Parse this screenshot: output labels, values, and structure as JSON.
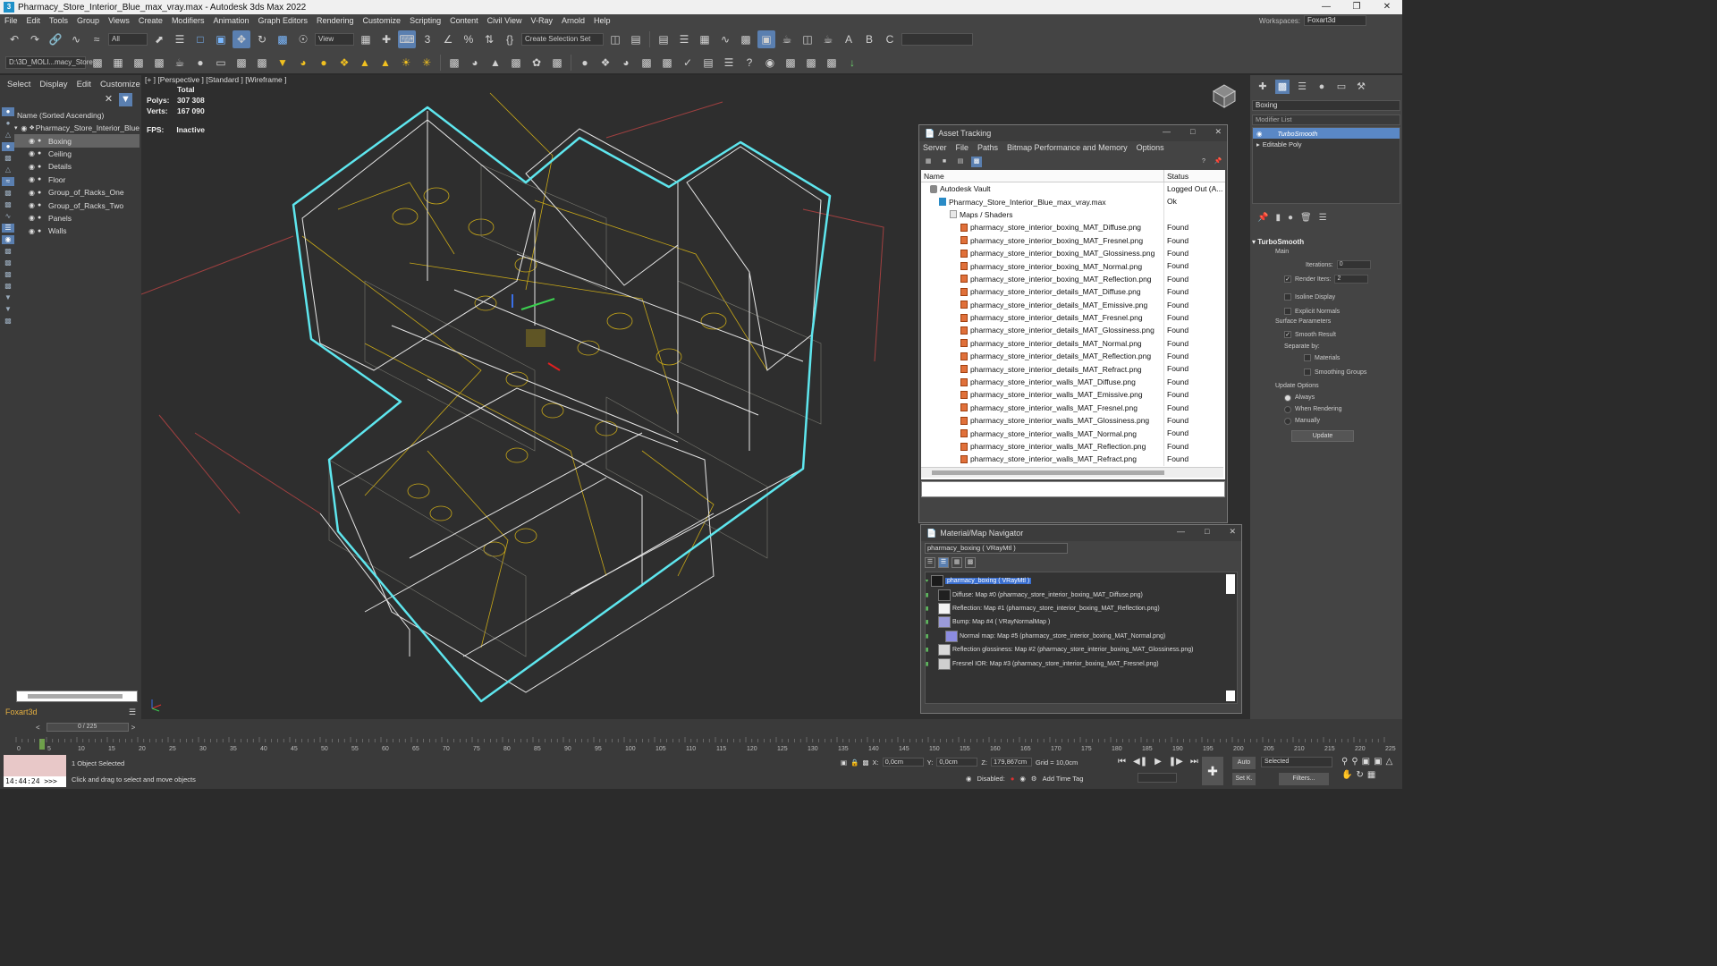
{
  "window": {
    "title": "Pharmacy_Store_Interior_Blue_max_vray.max - Autodesk 3ds Max 2022",
    "app_icon": "3"
  },
  "menu": [
    "File",
    "Edit",
    "Tools",
    "Group",
    "Views",
    "Create",
    "Modifiers",
    "Animation",
    "Graph Editors",
    "Rendering",
    "Customize",
    "Scripting",
    "Content",
    "Civil View",
    "V-Ray",
    "Arnold",
    "Help"
  ],
  "workspace": {
    "label": "Workspaces:",
    "value": "Foxart3d"
  },
  "toolbar": {
    "filter_dropdown": "All",
    "view_dropdown": "View",
    "selection_set": "Create Selection Set",
    "project_path": "D:\\3D_MOLI...macy_Store"
  },
  "scene_explorer": {
    "tabs": [
      "Select",
      "Display",
      "Edit",
      "Customize"
    ],
    "column_header": "Name (Sorted Ascending)",
    "root": "Pharmacy_Store_Interior_Blue",
    "items": [
      {
        "name": "Boxing",
        "selected": true
      },
      {
        "name": "Ceiling",
        "selected": false
      },
      {
        "name": "Details",
        "selected": false
      },
      {
        "name": "Floor",
        "selected": false
      },
      {
        "name": "Group_of_Racks_One",
        "selected": false
      },
      {
        "name": "Group_of_Racks_Two",
        "selected": false
      },
      {
        "name": "Panels",
        "selected": false
      },
      {
        "name": "Walls",
        "selected": false
      }
    ],
    "workspace_name": "Foxart3d"
  },
  "viewport": {
    "label": "[+ ] [Perspective ] [Standard ] [Wireframe ]",
    "stats_total": "Total",
    "polys_label": "Polys:",
    "polys_value": "307 308",
    "verts_label": "Verts:",
    "verts_value": "167 090",
    "fps_label": "FPS:",
    "fps_value": "Inactive"
  },
  "command_panel": {
    "object_name": "Boxing",
    "modifier_list": "Modifier List",
    "stack": [
      {
        "name": "TurboSmooth",
        "selected": true
      },
      {
        "name": "Editable Poly",
        "selected": false
      }
    ],
    "rollout_title": "TurboSmooth",
    "main_label": "Main",
    "iterations_label": "Iterations:",
    "iterations_value": "0",
    "render_iters_label": "Render Iters:",
    "render_iters_value": "2",
    "isoline_label": "Isoline Display",
    "explicit_normals_label": "Explicit Normals",
    "surface_params_label": "Surface Parameters",
    "smooth_result_label": "Smooth Result",
    "separate_by_label": "Separate by:",
    "materials_label": "Materials",
    "smoothing_groups_label": "Smoothing Groups",
    "update_options_label": "Update Options",
    "always_label": "Always",
    "when_rendering_label": "When Rendering",
    "manually_label": "Manually",
    "update_button": "Update"
  },
  "asset_tracking": {
    "title": "Asset Tracking",
    "menu": [
      "Server",
      "File",
      "Paths",
      "Bitmap Performance and Memory",
      "Options"
    ],
    "col_name": "Name",
    "col_status": "Status",
    "rows": [
      {
        "name": "Autodesk Vault",
        "status": "Logged Out (A...",
        "indent": 0,
        "icon": "vault"
      },
      {
        "name": "Pharmacy_Store_Interior_Blue_max_vray.max",
        "status": "Ok",
        "indent": 1,
        "icon": "max"
      },
      {
        "name": "Maps / Shaders",
        "status": "",
        "indent": 2,
        "icon": "folder"
      },
      {
        "name": "pharmacy_store_interior_boxing_MAT_Diffuse.png",
        "status": "Found",
        "indent": 3,
        "icon": "png"
      },
      {
        "name": "pharmacy_store_interior_boxing_MAT_Fresnel.png",
        "status": "Found",
        "indent": 3,
        "icon": "png"
      },
      {
        "name": "pharmacy_store_interior_boxing_MAT_Glossiness.png",
        "status": "Found",
        "indent": 3,
        "icon": "png"
      },
      {
        "name": "pharmacy_store_interior_boxing_MAT_Normal.png",
        "status": "Found",
        "indent": 3,
        "icon": "png"
      },
      {
        "name": "pharmacy_store_interior_boxing_MAT_Reflection.png",
        "status": "Found",
        "indent": 3,
        "icon": "png"
      },
      {
        "name": "pharmacy_store_interior_details_MAT_Diffuse.png",
        "status": "Found",
        "indent": 3,
        "icon": "png"
      },
      {
        "name": "pharmacy_store_interior_details_MAT_Emissive.png",
        "status": "Found",
        "indent": 3,
        "icon": "png"
      },
      {
        "name": "pharmacy_store_interior_details_MAT_Fresnel.png",
        "status": "Found",
        "indent": 3,
        "icon": "png"
      },
      {
        "name": "pharmacy_store_interior_details_MAT_Glossiness.png",
        "status": "Found",
        "indent": 3,
        "icon": "png"
      },
      {
        "name": "pharmacy_store_interior_details_MAT_Normal.png",
        "status": "Found",
        "indent": 3,
        "icon": "png"
      },
      {
        "name": "pharmacy_store_interior_details_MAT_Reflection.png",
        "status": "Found",
        "indent": 3,
        "icon": "png"
      },
      {
        "name": "pharmacy_store_interior_details_MAT_Refract.png",
        "status": "Found",
        "indent": 3,
        "icon": "png"
      },
      {
        "name": "pharmacy_store_interior_walls_MAT_Diffuse.png",
        "status": "Found",
        "indent": 3,
        "icon": "png"
      },
      {
        "name": "pharmacy_store_interior_walls_MAT_Emissive.png",
        "status": "Found",
        "indent": 3,
        "icon": "png"
      },
      {
        "name": "pharmacy_store_interior_walls_MAT_Fresnel.png",
        "status": "Found",
        "indent": 3,
        "icon": "png"
      },
      {
        "name": "pharmacy_store_interior_walls_MAT_Glossiness.png",
        "status": "Found",
        "indent": 3,
        "icon": "png"
      },
      {
        "name": "pharmacy_store_interior_walls_MAT_Normal.png",
        "status": "Found",
        "indent": 3,
        "icon": "png"
      },
      {
        "name": "pharmacy_store_interior_walls_MAT_Reflection.png",
        "status": "Found",
        "indent": 3,
        "icon": "png"
      },
      {
        "name": "pharmacy_store_interior_walls_MAT_Refract.png",
        "status": "Found",
        "indent": 3,
        "icon": "png"
      }
    ]
  },
  "material_navigator": {
    "title": "Material/Map Navigator",
    "path": "pharmacy_boxing  ( VRayMtl )",
    "rows": [
      {
        "text": "pharmacy_boxing  ( VRayMtl )",
        "selected": true,
        "swatch": "#1a1a1a",
        "indent": 0
      },
      {
        "text": "Diffuse: Map #0 (pharmacy_store_interior_boxing_MAT_Diffuse.png)",
        "selected": false,
        "swatch": "#202020",
        "indent": 1
      },
      {
        "text": "Reflection: Map #1 (pharmacy_store_interior_boxing_MAT_Reflection.png)",
        "selected": false,
        "swatch": "#f4f4f4",
        "indent": 1
      },
      {
        "text": "Bump: Map #4  ( VRayNormalMap )",
        "selected": false,
        "swatch": "#9a9ad8",
        "indent": 1
      },
      {
        "text": "Normal map: Map #5 (pharmacy_store_interior_boxing_MAT_Normal.png)",
        "selected": false,
        "swatch": "#8c8ce0",
        "indent": 2
      },
      {
        "text": "Reflection glossiness: Map #2 (pharmacy_store_interior_boxing_MAT_Glossiness.png)",
        "selected": false,
        "swatch": "#d8d8d8",
        "indent": 1
      },
      {
        "text": "Fresnel IOR: Map #3 (pharmacy_store_interior_boxing_MAT_Fresnel.png)",
        "selected": false,
        "swatch": "#cfcfcf",
        "indent": 1
      }
    ]
  },
  "timeline": {
    "frame_display": "0 / 225",
    "ticks": [
      "0",
      "5",
      "10",
      "15",
      "20",
      "25",
      "30",
      "35",
      "40",
      "45",
      "50",
      "55",
      "60",
      "65",
      "70",
      "75",
      "80",
      "85",
      "90",
      "95",
      "100",
      "105",
      "110",
      "115",
      "120",
      "125",
      "130",
      "135",
      "140",
      "145",
      "150",
      "155",
      "160",
      "165",
      "170",
      "175",
      "180",
      "185",
      "190",
      "195",
      "200",
      "205",
      "210",
      "215",
      "220",
      "225"
    ]
  },
  "status": {
    "clock": "14:44:24 >>>",
    "selection": "1 Object Selected",
    "hint": "Click and drag to select and move objects",
    "x_label": "X:",
    "x_value": "0,0cm",
    "y_label": "Y:",
    "y_value": "0,0cm",
    "z_label": "Z:",
    "z_value": "179,867cm",
    "grid": "Grid = 10,0cm",
    "disabled_label": "Disabled:",
    "add_time_tag": "Add Time Tag",
    "auto_label": "Auto",
    "set_key_label": "Set K.",
    "selected_dropdown": "Selected",
    "filters_label": "Filters..."
  },
  "colors": {
    "selection_blue": "#5a7fb0",
    "wire_cyan": "#5ee6ee",
    "wire_white": "#e8e8e8",
    "wire_yellow": "#e0c020",
    "clock_bg": "#e8c8c8"
  }
}
